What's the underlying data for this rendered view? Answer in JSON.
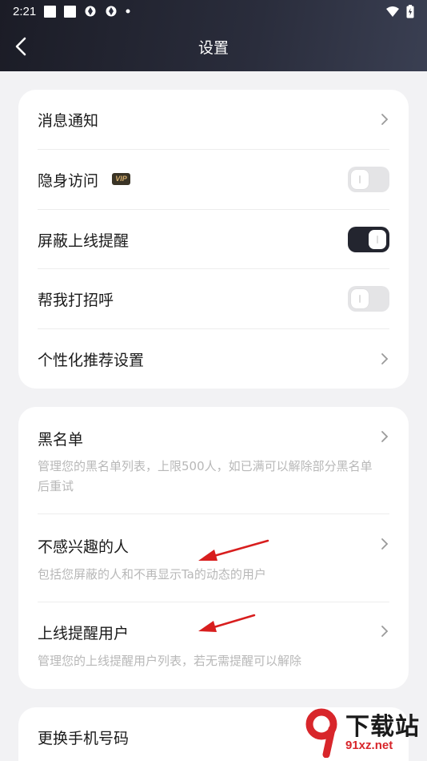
{
  "status_bar": {
    "time": "2:21"
  },
  "header": {
    "title": "设置"
  },
  "group1": {
    "items": [
      {
        "label": "消息通知",
        "control": "chevron"
      },
      {
        "label": "隐身访问",
        "badge": "VIP",
        "control": "toggle",
        "on": false
      },
      {
        "label": "屏蔽上线提醒",
        "control": "toggle",
        "on": true
      },
      {
        "label": "帮我打招呼",
        "control": "toggle",
        "on": false
      },
      {
        "label": "个性化推荐设置",
        "control": "chevron"
      }
    ]
  },
  "group2": {
    "items": [
      {
        "label": "黑名单",
        "desc": "管理您的黑名单列表，上限500人，如已满可以解除部分黑名单后重试"
      },
      {
        "label": "不感兴趣的人",
        "desc": "包括您屏蔽的人和不再显示Ta的动态的用户"
      },
      {
        "label": "上线提醒用户",
        "desc": "管理您的上线提醒用户列表，若无需提醒可以解除"
      }
    ]
  },
  "group3": {
    "items": [
      {
        "label": "更换手机号码"
      }
    ]
  },
  "watermark": {
    "text1": "下载站",
    "text2": "91xz.net"
  },
  "colors": {
    "header_dark": "#1b1c26",
    "toggle_on": "#23252f",
    "annotation_arrow": "#d81e1e"
  }
}
